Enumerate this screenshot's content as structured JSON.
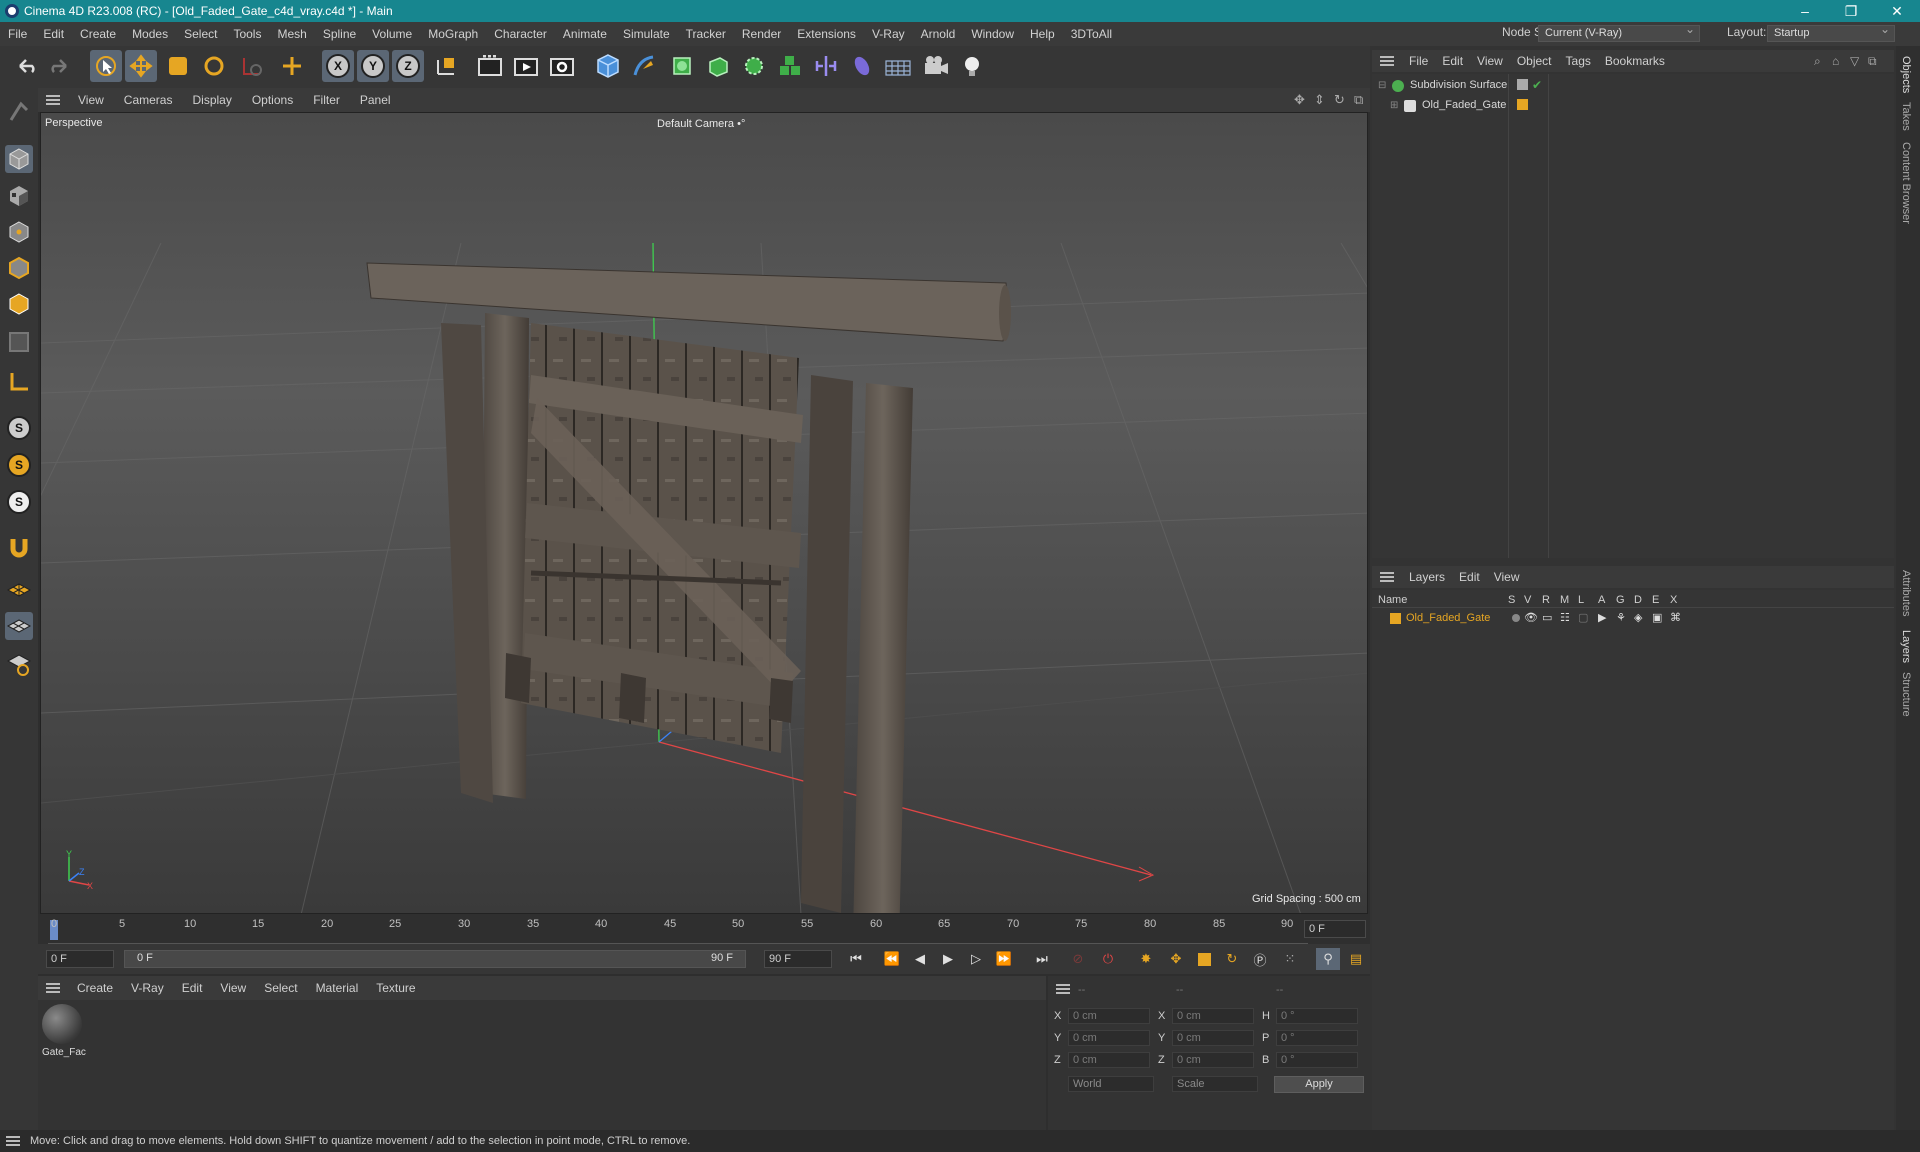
{
  "window": {
    "title": "Cinema 4D R23.008 (RC) - [Old_Faded_Gate_c4d_vray.c4d *] - Main",
    "controls": [
      "–",
      "❐",
      "✕"
    ]
  },
  "menubar": {
    "items": [
      "File",
      "Edit",
      "Create",
      "Modes",
      "Select",
      "Tools",
      "Mesh",
      "Spline",
      "Volume",
      "MoGraph",
      "Character",
      "Animate",
      "Simulate",
      "Tracker",
      "Render",
      "Extensions",
      "V-Ray",
      "Arnold",
      "Window",
      "Help",
      "3DToAll"
    ],
    "node_space_label": "Node Space:",
    "node_space_value": "Current (V-Ray)",
    "layout_label": "Layout:",
    "layout_value": "Startup"
  },
  "toolbar": {
    "axis_x": "X",
    "axis_y": "Y",
    "axis_z": "Z",
    "icons": [
      "undo-icon",
      "redo-icon",
      "select-icon",
      "move-icon",
      "scale-icon",
      "rotate-icon",
      "recent-tool-icon",
      "axis-x-icon",
      "axis-y-icon",
      "axis-z-icon",
      "coordinate-system-icon",
      "render-region-icon",
      "render-view-icon",
      "render-settings-icon",
      "cube-icon",
      "pen-icon",
      "subdivision-icon",
      "extrude-icon",
      "array-icon",
      "cloner-icon",
      "symmetry-icon",
      "deformer-icon",
      "floor-icon",
      "camera-icon",
      "light-icon"
    ]
  },
  "viewport": {
    "menu": [
      "View",
      "Cameras",
      "Display",
      "Options",
      "Filter",
      "Panel"
    ],
    "projection": "Perspective",
    "camera": "Default Camera",
    "camera_marker": "•°",
    "grid_spacing": "Grid Spacing : 500 cm",
    "axis_x": "X",
    "axis_y": "Y",
    "axis_z": "Z"
  },
  "timeline": {
    "ticks": [
      "0",
      "5",
      "10",
      "15",
      "20",
      "25",
      "30",
      "35",
      "40",
      "45",
      "50",
      "55",
      "60",
      "65",
      "70",
      "75",
      "80",
      "85",
      "90"
    ],
    "current_frame": "0 F",
    "start_field": "0 F",
    "range_start": "0 F",
    "range_end": "90 F",
    "end_field": "90 F"
  },
  "material_manager": {
    "menu": [
      "Create",
      "V-Ray",
      "Edit",
      "View",
      "Select",
      "Material",
      "Texture"
    ],
    "materials": [
      {
        "name": "Gate_Fac"
      }
    ]
  },
  "attributes": {
    "headers": [
      "--",
      "--",
      "--"
    ],
    "rows": [
      {
        "l1": "X",
        "v1": "0 cm",
        "l2": "X",
        "v2": "0 cm",
        "l3": "H",
        "v3": "0 °"
      },
      {
        "l1": "Y",
        "v1": "0 cm",
        "l2": "Y",
        "v2": "0 cm",
        "l3": "P",
        "v3": "0 °"
      },
      {
        "l1": "Z",
        "v1": "0 cm",
        "l2": "Z",
        "v2": "0 cm",
        "l3": "B",
        "v3": "0 °"
      }
    ],
    "coord_system": "World",
    "mode": "Scale",
    "apply_label": "Apply"
  },
  "object_manager": {
    "menu": [
      "File",
      "Edit",
      "View",
      "Object",
      "Tags",
      "Bookmarks"
    ],
    "objects": [
      {
        "name": "Subdivision Surface",
        "color": "#4caf50"
      },
      {
        "name": "Old_Faded_Gate",
        "color": "#e6a623"
      }
    ]
  },
  "layer_manager": {
    "menu": [
      "Layers",
      "Edit",
      "View"
    ],
    "columns": [
      "Name",
      "S",
      "V",
      "R",
      "M",
      "L",
      "A",
      "G",
      "D",
      "E",
      "X"
    ],
    "layers": [
      {
        "name": "Old_Faded_Gate",
        "color": "#e6a623"
      }
    ]
  },
  "side_tabs": [
    "Objects",
    "Takes",
    "Content Browser",
    "Attributes",
    "Layers",
    "Structure"
  ],
  "status": {
    "text": "Move: Click and drag to move elements. Hold down SHIFT to quantize movement / add to the selection in point mode, CTRL to remove."
  },
  "colors": {
    "accent": "#e6a623",
    "title_bar": "#17868f",
    "axis_x": "#e04646",
    "axis_y": "#3ecf4f",
    "axis_z": "#3b82f6"
  }
}
